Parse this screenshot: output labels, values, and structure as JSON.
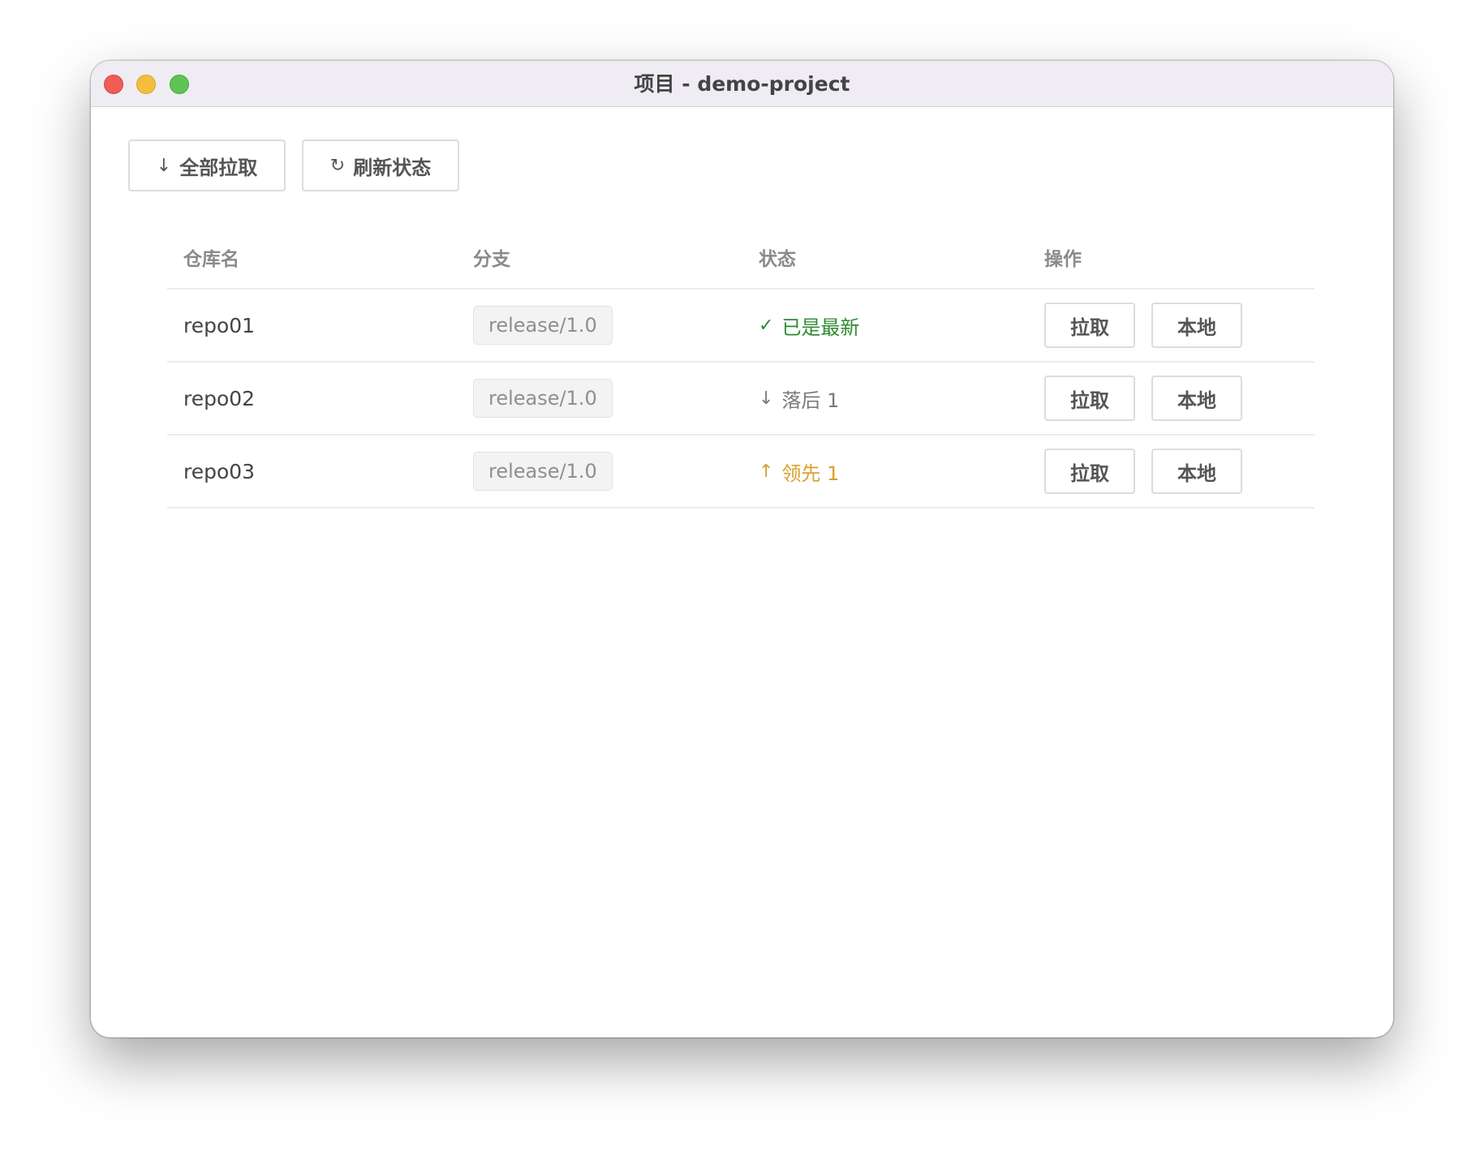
{
  "window": {
    "title": "项目 - demo-project"
  },
  "toolbar": {
    "pull_all": {
      "icon": "↓",
      "label": "全部拉取"
    },
    "refresh": {
      "icon": "↻",
      "label": "刷新状态"
    }
  },
  "table": {
    "headers": [
      "仓库名",
      "分支",
      "状态",
      "操作"
    ],
    "rows": [
      {
        "repo": "repo01",
        "branch": "release/1.0",
        "status_icon": "✓",
        "status": "已是最新",
        "pull_label": "拉取",
        "local_label": "本地"
      },
      {
        "repo": "repo02",
        "branch": "release/1.0",
        "status_icon": "↓",
        "status": "落后 1",
        "pull_label": "拉取",
        "local_label": "本地"
      },
      {
        "repo": "repo03",
        "branch": "release/1.0",
        "status_icon": "↑",
        "status": "领先 1",
        "pull_label": "拉取",
        "local_label": "本地"
      }
    ]
  },
  "colors": {
    "status_latest": "#2e8b32",
    "status_behind": "#7a7a7a",
    "status_ahead": "#d9a030"
  }
}
